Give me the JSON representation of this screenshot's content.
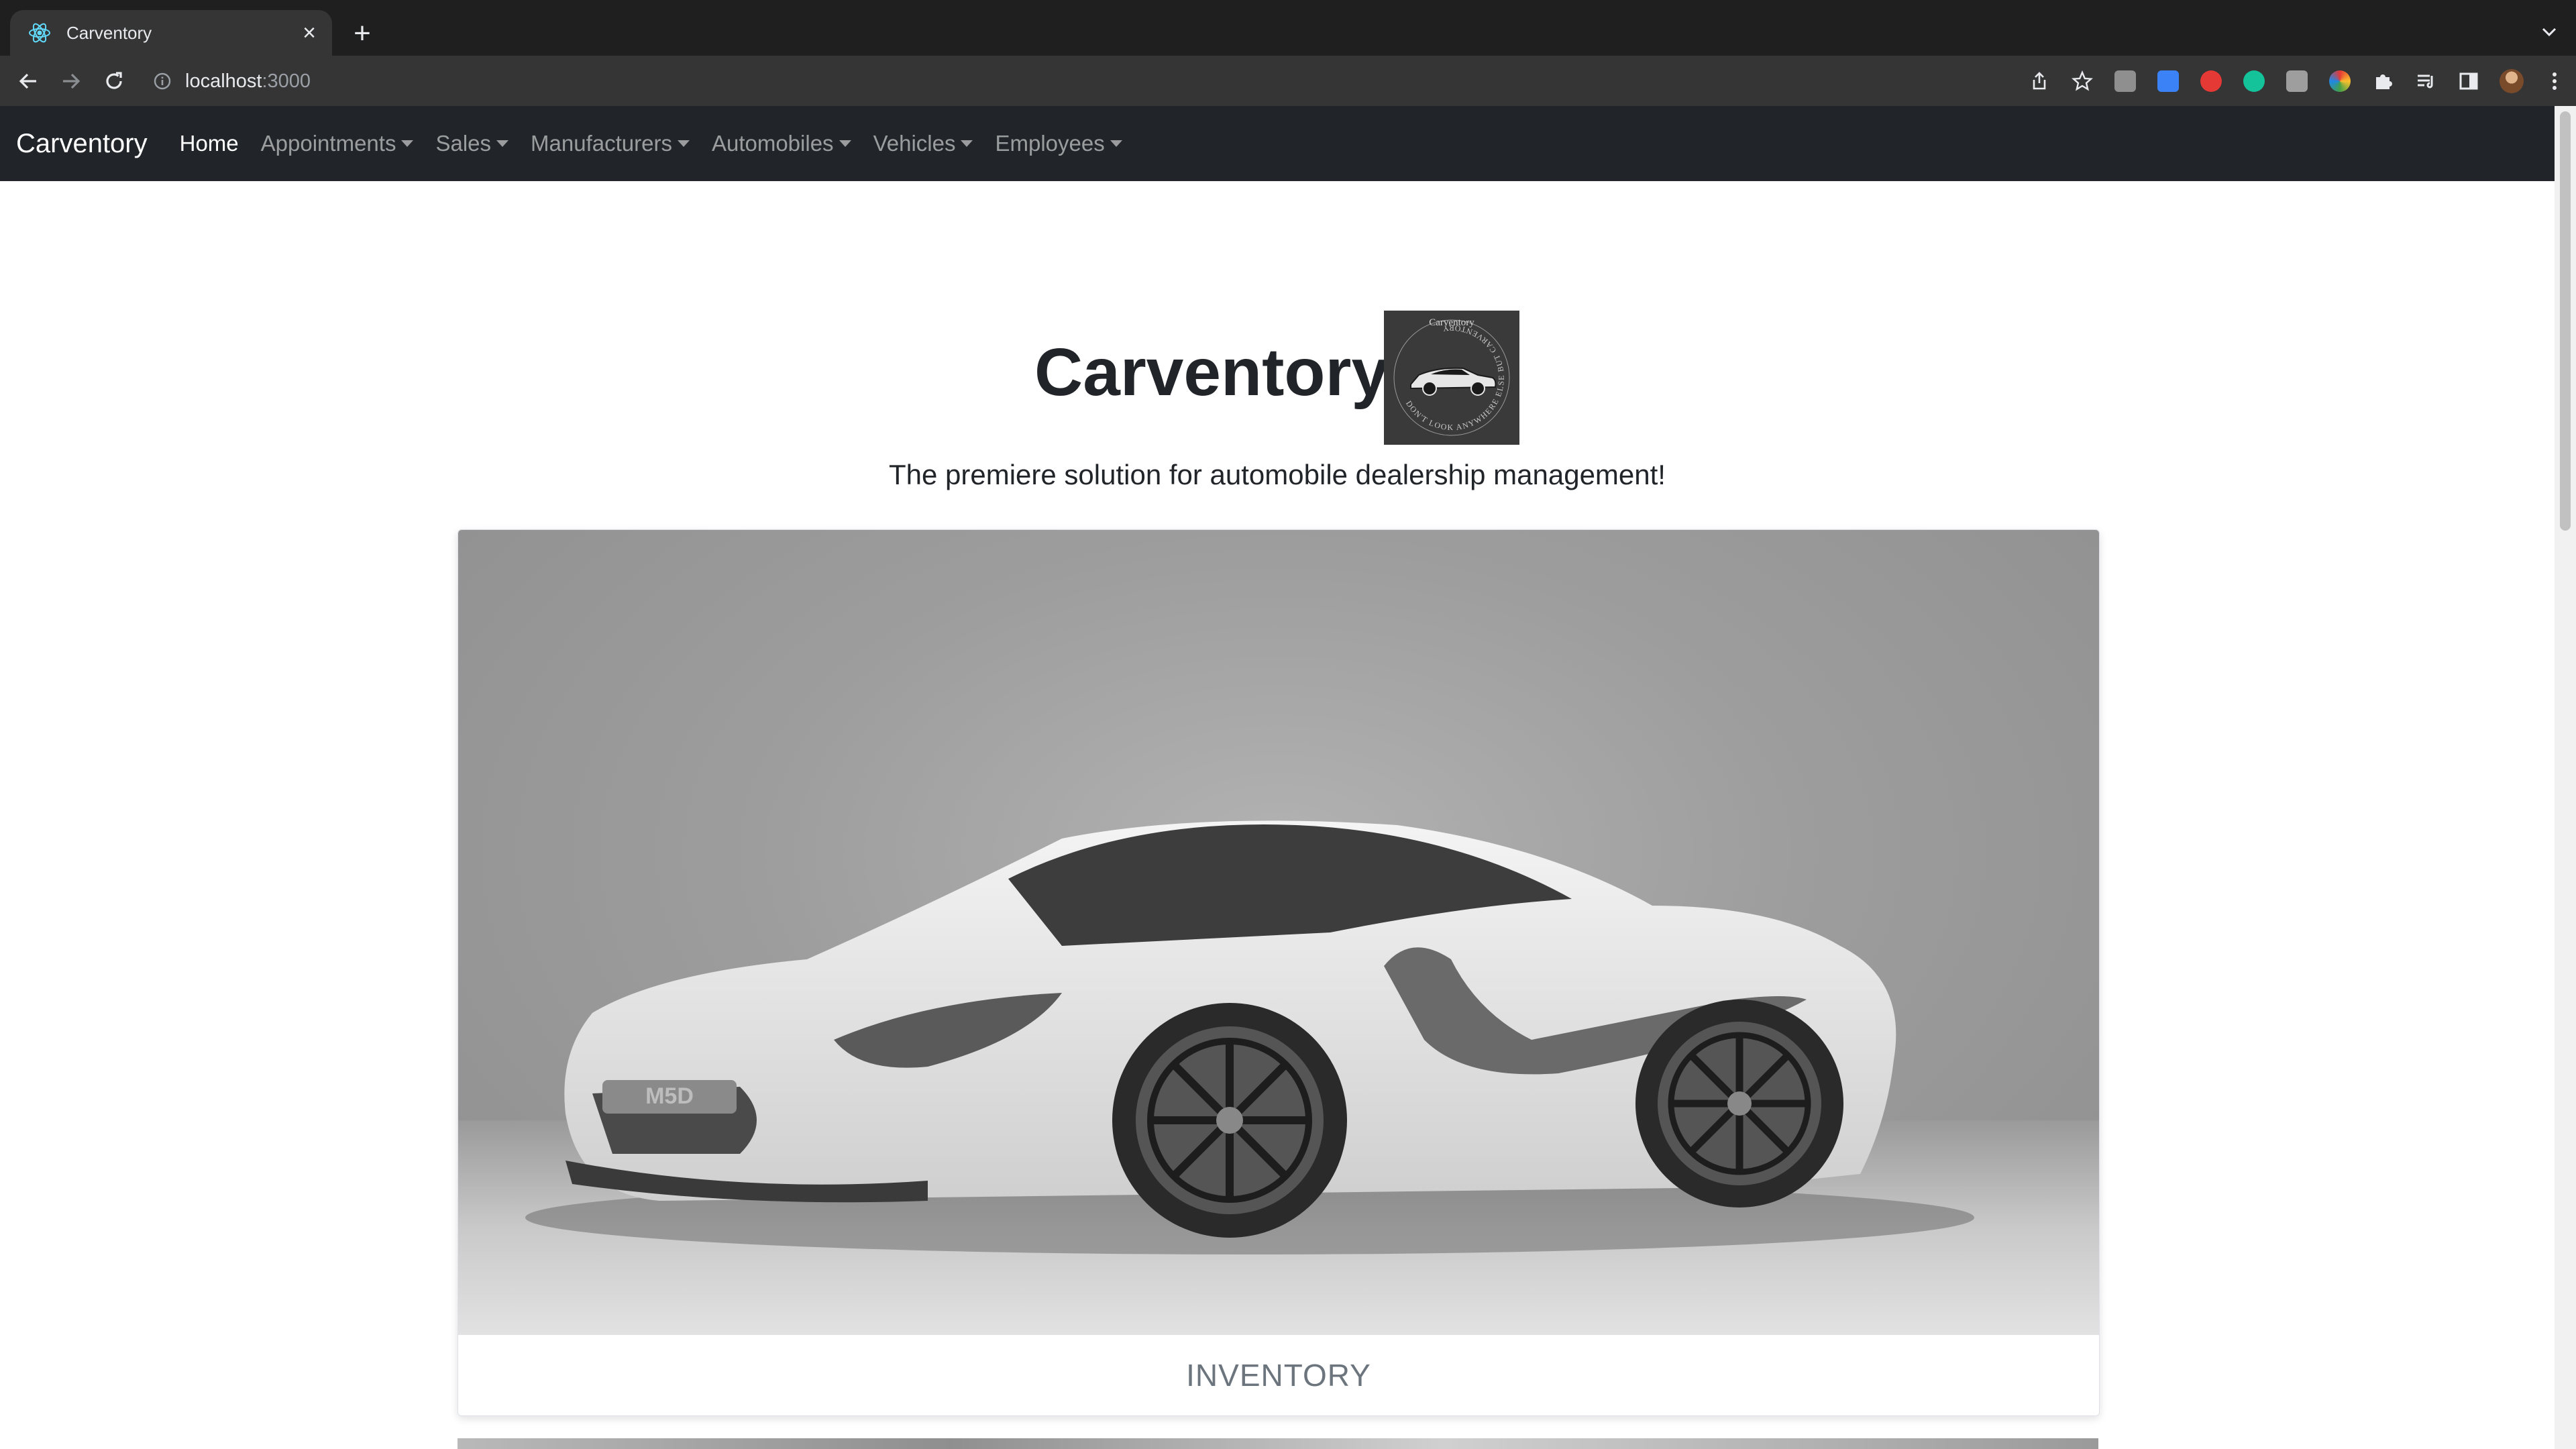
{
  "browser": {
    "tab_title": "Carventory",
    "url_host": "localhost",
    "url_port": ":3000",
    "icons": [
      "react-favicon-icon",
      "close-icon",
      "plus-icon",
      "chevron-down-icon",
      "back-arrow-icon",
      "forward-arrow-icon",
      "reload-icon",
      "info-icon",
      "share-icon",
      "star-icon",
      "extensions-puzzle-icon",
      "reading-list-icon",
      "side-panel-icon",
      "profile-avatar-icon",
      "kebab-menu-icon"
    ]
  },
  "navbar": {
    "brand": "Carventory",
    "items": [
      {
        "label": "Home",
        "active": true,
        "dropdown": false
      },
      {
        "label": "Appointments",
        "active": false,
        "dropdown": true
      },
      {
        "label": "Sales",
        "active": false,
        "dropdown": true
      },
      {
        "label": "Manufacturers",
        "active": false,
        "dropdown": true
      },
      {
        "label": "Automobiles",
        "active": false,
        "dropdown": true
      },
      {
        "label": "Vehicles",
        "active": false,
        "dropdown": true
      },
      {
        "label": "Employees",
        "active": false,
        "dropdown": true
      }
    ]
  },
  "hero": {
    "title": "Carventory",
    "lead": "The premiere solution for automobile dealership management!",
    "logo_text_top": "Carventory",
    "logo_text_ring": "DON'T LOOK ANYWHERE ELSE BUT CARVENTORY"
  },
  "card": {
    "footer_label": "INVENTORY",
    "plate_text": "M5D"
  },
  "colors": {
    "navbar_bg": "#212529",
    "tab_strip": "#1f1f1f",
    "toolbar": "#353535",
    "card_footer_text": "#6c757d"
  }
}
